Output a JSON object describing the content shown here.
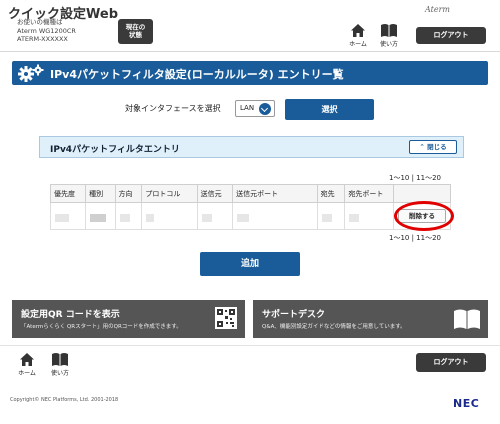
{
  "header": {
    "app_title": "クイック設定Web",
    "device_label": "お使いの機種は",
    "device_model": "Aterm WG1200CR",
    "device_id": "ATERM-XXXXXX",
    "status_button_line1": "現在の",
    "status_button_line2": "状態",
    "home_label": "ホーム",
    "guide_label": "使い方",
    "brand": "Aterm",
    "logout_label": "ログアウト"
  },
  "page_title": "IPv4パケットフィルタ設定(ローカルルータ) エントリー覧",
  "interface_selector": {
    "label": "対象インタフェースを選択",
    "value": "LAN",
    "select_button": "選択"
  },
  "section": {
    "title": "IPv4パケットフィルタエントリ",
    "close_button": "閉じる"
  },
  "pager_top": "1～10 | 11～20",
  "pager_bottom": "1～10 | 11～20",
  "table": {
    "columns": [
      "優先度",
      "種別",
      "方向",
      "プロトコル",
      "送信元",
      "送信元ポート",
      "宛先",
      "宛先ポート",
      ""
    ],
    "rows": [
      {
        "delete_label": "削除する"
      }
    ]
  },
  "add_button": "追加",
  "banners": {
    "qr": {
      "title": "設定用QR コードを表示",
      "subtitle": "「Atermらくらく QRスタート」用のQRコードを作成できます。"
    },
    "support": {
      "title": "サポートデスク",
      "subtitle": "Q&A、機能別設定ガイドなどの情報をご用意しています。"
    }
  },
  "footer": {
    "home_label": "ホーム",
    "guide_label": "使い方",
    "logout_label": "ログアウト",
    "copyright": "Copyright© NEC Platforms, Ltd. 2001-2018",
    "logo": "NEC"
  },
  "colors": {
    "primary_blue": "#1a5c99",
    "dark_button": "#3a3a3a",
    "banner_gray": "#555555",
    "highlight_red": "#e00000"
  }
}
